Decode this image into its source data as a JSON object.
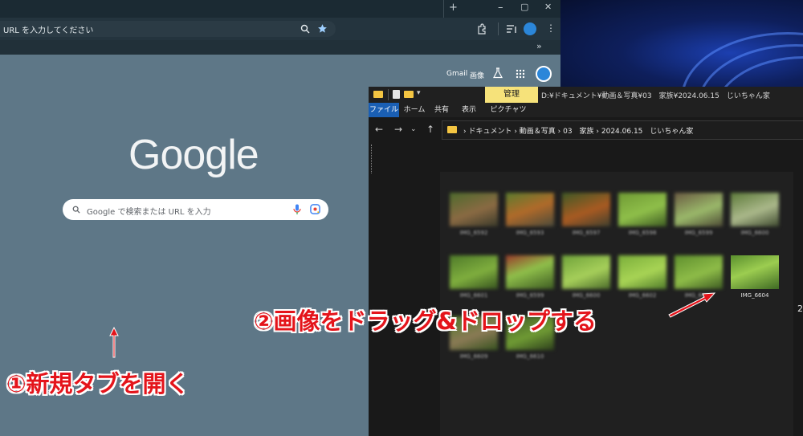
{
  "chrome": {
    "address_text": "URL を入力してください",
    "new_tab_btn": "+",
    "win_min": "–",
    "win_max": "▢",
    "win_close": "✕",
    "bookmarks_more": "»",
    "links": {
      "gmail": "Gmail",
      "images": "画像"
    },
    "logo": "Google",
    "search_placeholder": "Google で検索または URL を入力"
  },
  "explorer": {
    "manage_tab": "管理",
    "title_path": "D:¥ドキュメント¥動画＆写真¥03　家族¥2024.06.15　じいちゃん家",
    "ribbon_tabs": [
      "ファイル",
      "ホーム",
      "共有",
      "表示",
      "ピクチャツール"
    ],
    "breadcrumb": "›  ドキュメント  ›  動画＆写真  ›  03　家族  ›  2024.06.15　じいちゃん家",
    "files": [
      {
        "label": "IMG_6592"
      },
      {
        "label": "IMG_6593"
      },
      {
        "label": "IMG_6597"
      },
      {
        "label": "IMG_6598"
      },
      {
        "label": "IMG_6599"
      },
      {
        "label": "IMG_6600"
      },
      {
        "label": "IMG_6601"
      },
      {
        "label": "IMG_6599"
      },
      {
        "label": "IMG_6600"
      },
      {
        "label": "IMG_6602"
      },
      {
        "label": "IMG_6603"
      },
      {
        "label": "IMG_6604"
      },
      {
        "label": "IMG_6609"
      },
      {
        "label": "IMG_6610"
      }
    ],
    "edge_digit": "2"
  },
  "annotations": {
    "step1": "①新規タブを開く",
    "step2": "②画像をドラッグ&ドロップする"
  },
  "colors": {
    "annotation": "#e4141b",
    "manage_tab": "#f6e27a",
    "file_tab": "#1a5fb4"
  }
}
